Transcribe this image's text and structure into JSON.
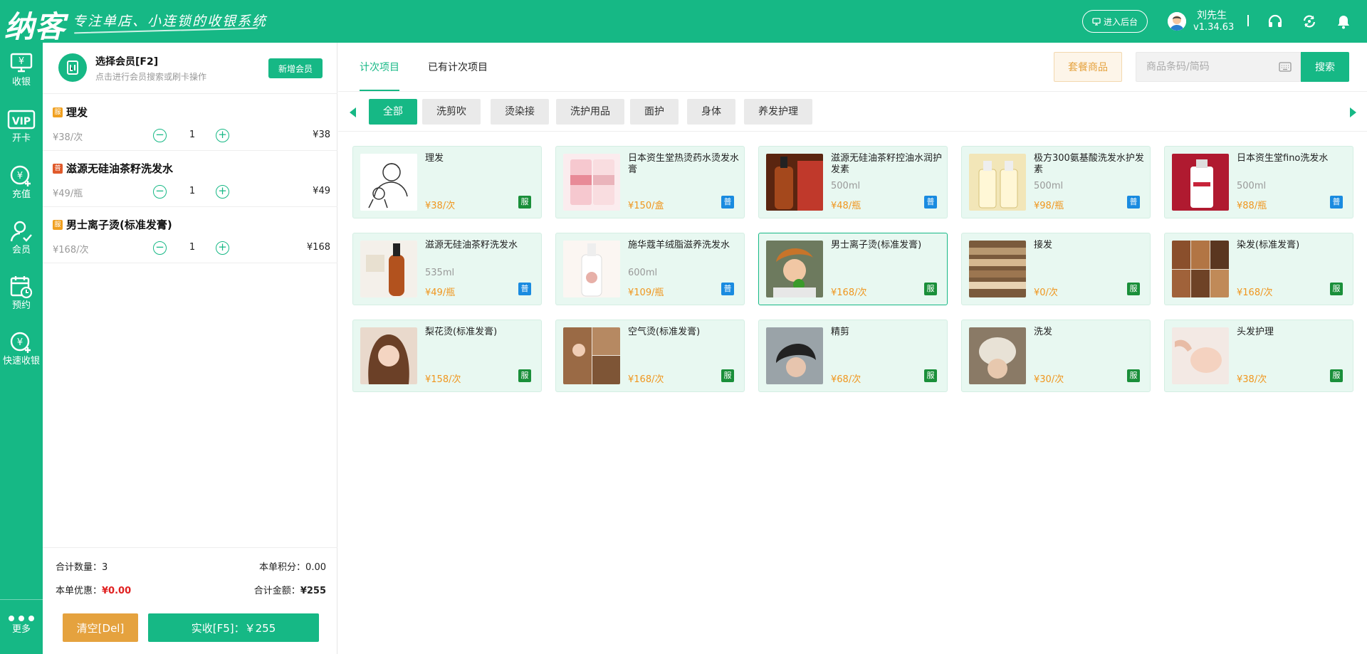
{
  "app": {
    "logo": "纳客",
    "slogan": "专注单店、小连锁的收银系统",
    "admin_label": "进入后台",
    "user_name": "刘先生",
    "version": "v1.34.63"
  },
  "sidebar": {
    "items": [
      {
        "label": "收银"
      },
      {
        "label": "开卡"
      },
      {
        "label": "充值"
      },
      {
        "label": "会员"
      },
      {
        "label": "预约"
      },
      {
        "label": "快速收银"
      }
    ],
    "more_label": "更多"
  },
  "member": {
    "title": "选择会员[F2]",
    "hint": "点击进行会员搜索或刷卡操作",
    "new_label": "新增会员"
  },
  "cart": {
    "items": [
      {
        "badge": "服",
        "name": "理发",
        "unit": "¥38/次",
        "qty": "1",
        "total": "¥38"
      },
      {
        "badge": "普",
        "name": "滋源无硅油茶籽洗发水",
        "unit": "¥49/瓶",
        "qty": "1",
        "total": "¥49"
      },
      {
        "badge": "服",
        "name": "男士离子烫(标准发膏)",
        "unit": "¥168/次",
        "qty": "1",
        "total": "¥168"
      }
    ],
    "totals": {
      "count_label": "合计数量：",
      "count": "3",
      "points_label": "本单积分：",
      "points": "0.00",
      "discount_label": "本单优惠：",
      "discount": "¥0.00",
      "amount_label": "合计金额：",
      "amount": "¥255"
    },
    "clear_label": "清空[Del]",
    "pay_label": "实收[F5]：￥255"
  },
  "main": {
    "tabs": [
      {
        "label": "计次项目"
      },
      {
        "label": "已有计次项目"
      }
    ],
    "package_label": "套餐商品",
    "search_placeholder": "商品条码/简码",
    "search_label": "搜索",
    "categories": [
      "全部",
      "洗剪吹",
      "烫染接",
      "洗护用品",
      "面护",
      "身体",
      "养发护理"
    ],
    "products": [
      {
        "name": "理发",
        "spec": "",
        "price": "¥38/次",
        "badge": "服"
      },
      {
        "name": "日本资生堂热烫药水烫发水膏",
        "spec": "",
        "price": "¥150/盒",
        "badge": "普"
      },
      {
        "name": "滋源无硅油茶籽控油水润护发素",
        "spec": "500ml",
        "price": "¥48/瓶",
        "badge": "普"
      },
      {
        "name": "极方300氨基酸洗发水护发素",
        "spec": "500ml",
        "price": "¥98/瓶",
        "badge": "普"
      },
      {
        "name": "日本资生堂fino洗发水",
        "spec": "500ml",
        "price": "¥88/瓶",
        "badge": "普"
      },
      {
        "name": "滋源无硅油茶籽洗发水",
        "spec": "535ml",
        "price": "¥49/瓶",
        "badge": "普"
      },
      {
        "name": "施华蔻羊绒脂滋养洗发水",
        "spec": "600ml",
        "price": "¥109/瓶",
        "badge": "普"
      },
      {
        "name": "男士离子烫(标准发膏)",
        "spec": "",
        "price": "¥168/次",
        "badge": "服"
      },
      {
        "name": "接发",
        "spec": "",
        "price": "¥0/次",
        "badge": "服"
      },
      {
        "name": "染发(标准发膏)",
        "spec": "",
        "price": "¥168/次",
        "badge": "服"
      },
      {
        "name": "梨花烫(标准发膏)",
        "spec": "",
        "price": "¥158/次",
        "badge": "服"
      },
      {
        "name": "空气烫(标准发膏)",
        "spec": "",
        "price": "¥168/次",
        "badge": "服"
      },
      {
        "name": "精剪",
        "spec": "",
        "price": "¥68/次",
        "badge": "服"
      },
      {
        "name": "洗发",
        "spec": "",
        "price": "¥30/次",
        "badge": "服"
      },
      {
        "name": "头发护理",
        "spec": "",
        "price": "¥38/次",
        "badge": "服"
      }
    ]
  },
  "colors": {
    "brand": "#16b885",
    "accent": "#e5a23e",
    "price": "#f0961e",
    "service_badge": "#1a8f3a",
    "product_badge": "#1a8be0",
    "discount": "#e02020"
  }
}
